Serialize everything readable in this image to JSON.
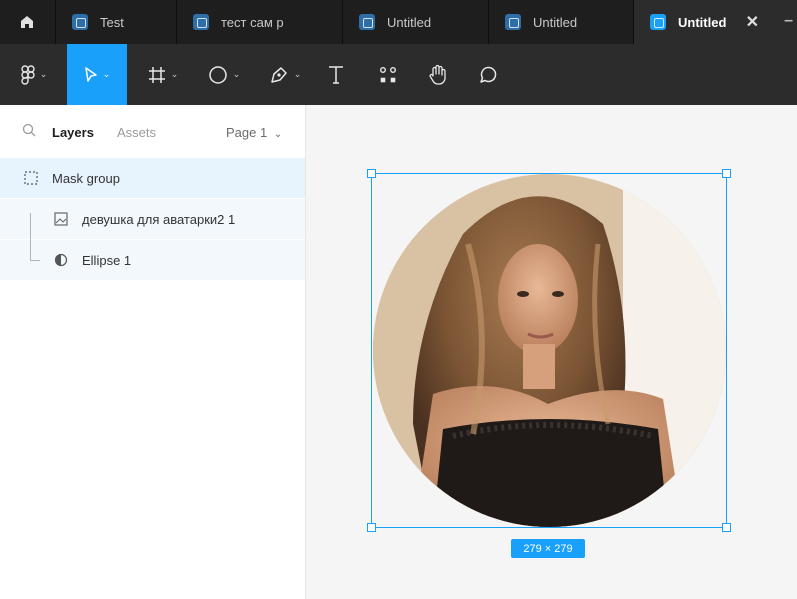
{
  "tabs": [
    {
      "label": "Test"
    },
    {
      "label": "тест сам р"
    },
    {
      "label": "Untitled"
    },
    {
      "label": "Untitled"
    },
    {
      "label": "Untitled",
      "active": true
    }
  ],
  "tab_close": "✕",
  "tab_extra": "–",
  "toolbar": {
    "tools": [
      "figma-menu",
      "move",
      "frame",
      "ellipse",
      "pen",
      "text",
      "resources",
      "hand",
      "comment"
    ]
  },
  "sidebar": {
    "tab_layers": "Layers",
    "tab_assets": "Assets",
    "page_selector": "Page 1",
    "layers": [
      {
        "label": "Mask group",
        "icon": "mask-group-icon"
      },
      {
        "label": "девушка для аватарки2 1",
        "icon": "image-icon"
      },
      {
        "label": "Ellipse 1",
        "icon": "mask-icon"
      }
    ]
  },
  "canvas": {
    "size_label": "279 × 279"
  },
  "colors": {
    "accent": "#18a0fb",
    "tabbar": "#1e1e1e",
    "toolbar": "#2c2c2c"
  }
}
